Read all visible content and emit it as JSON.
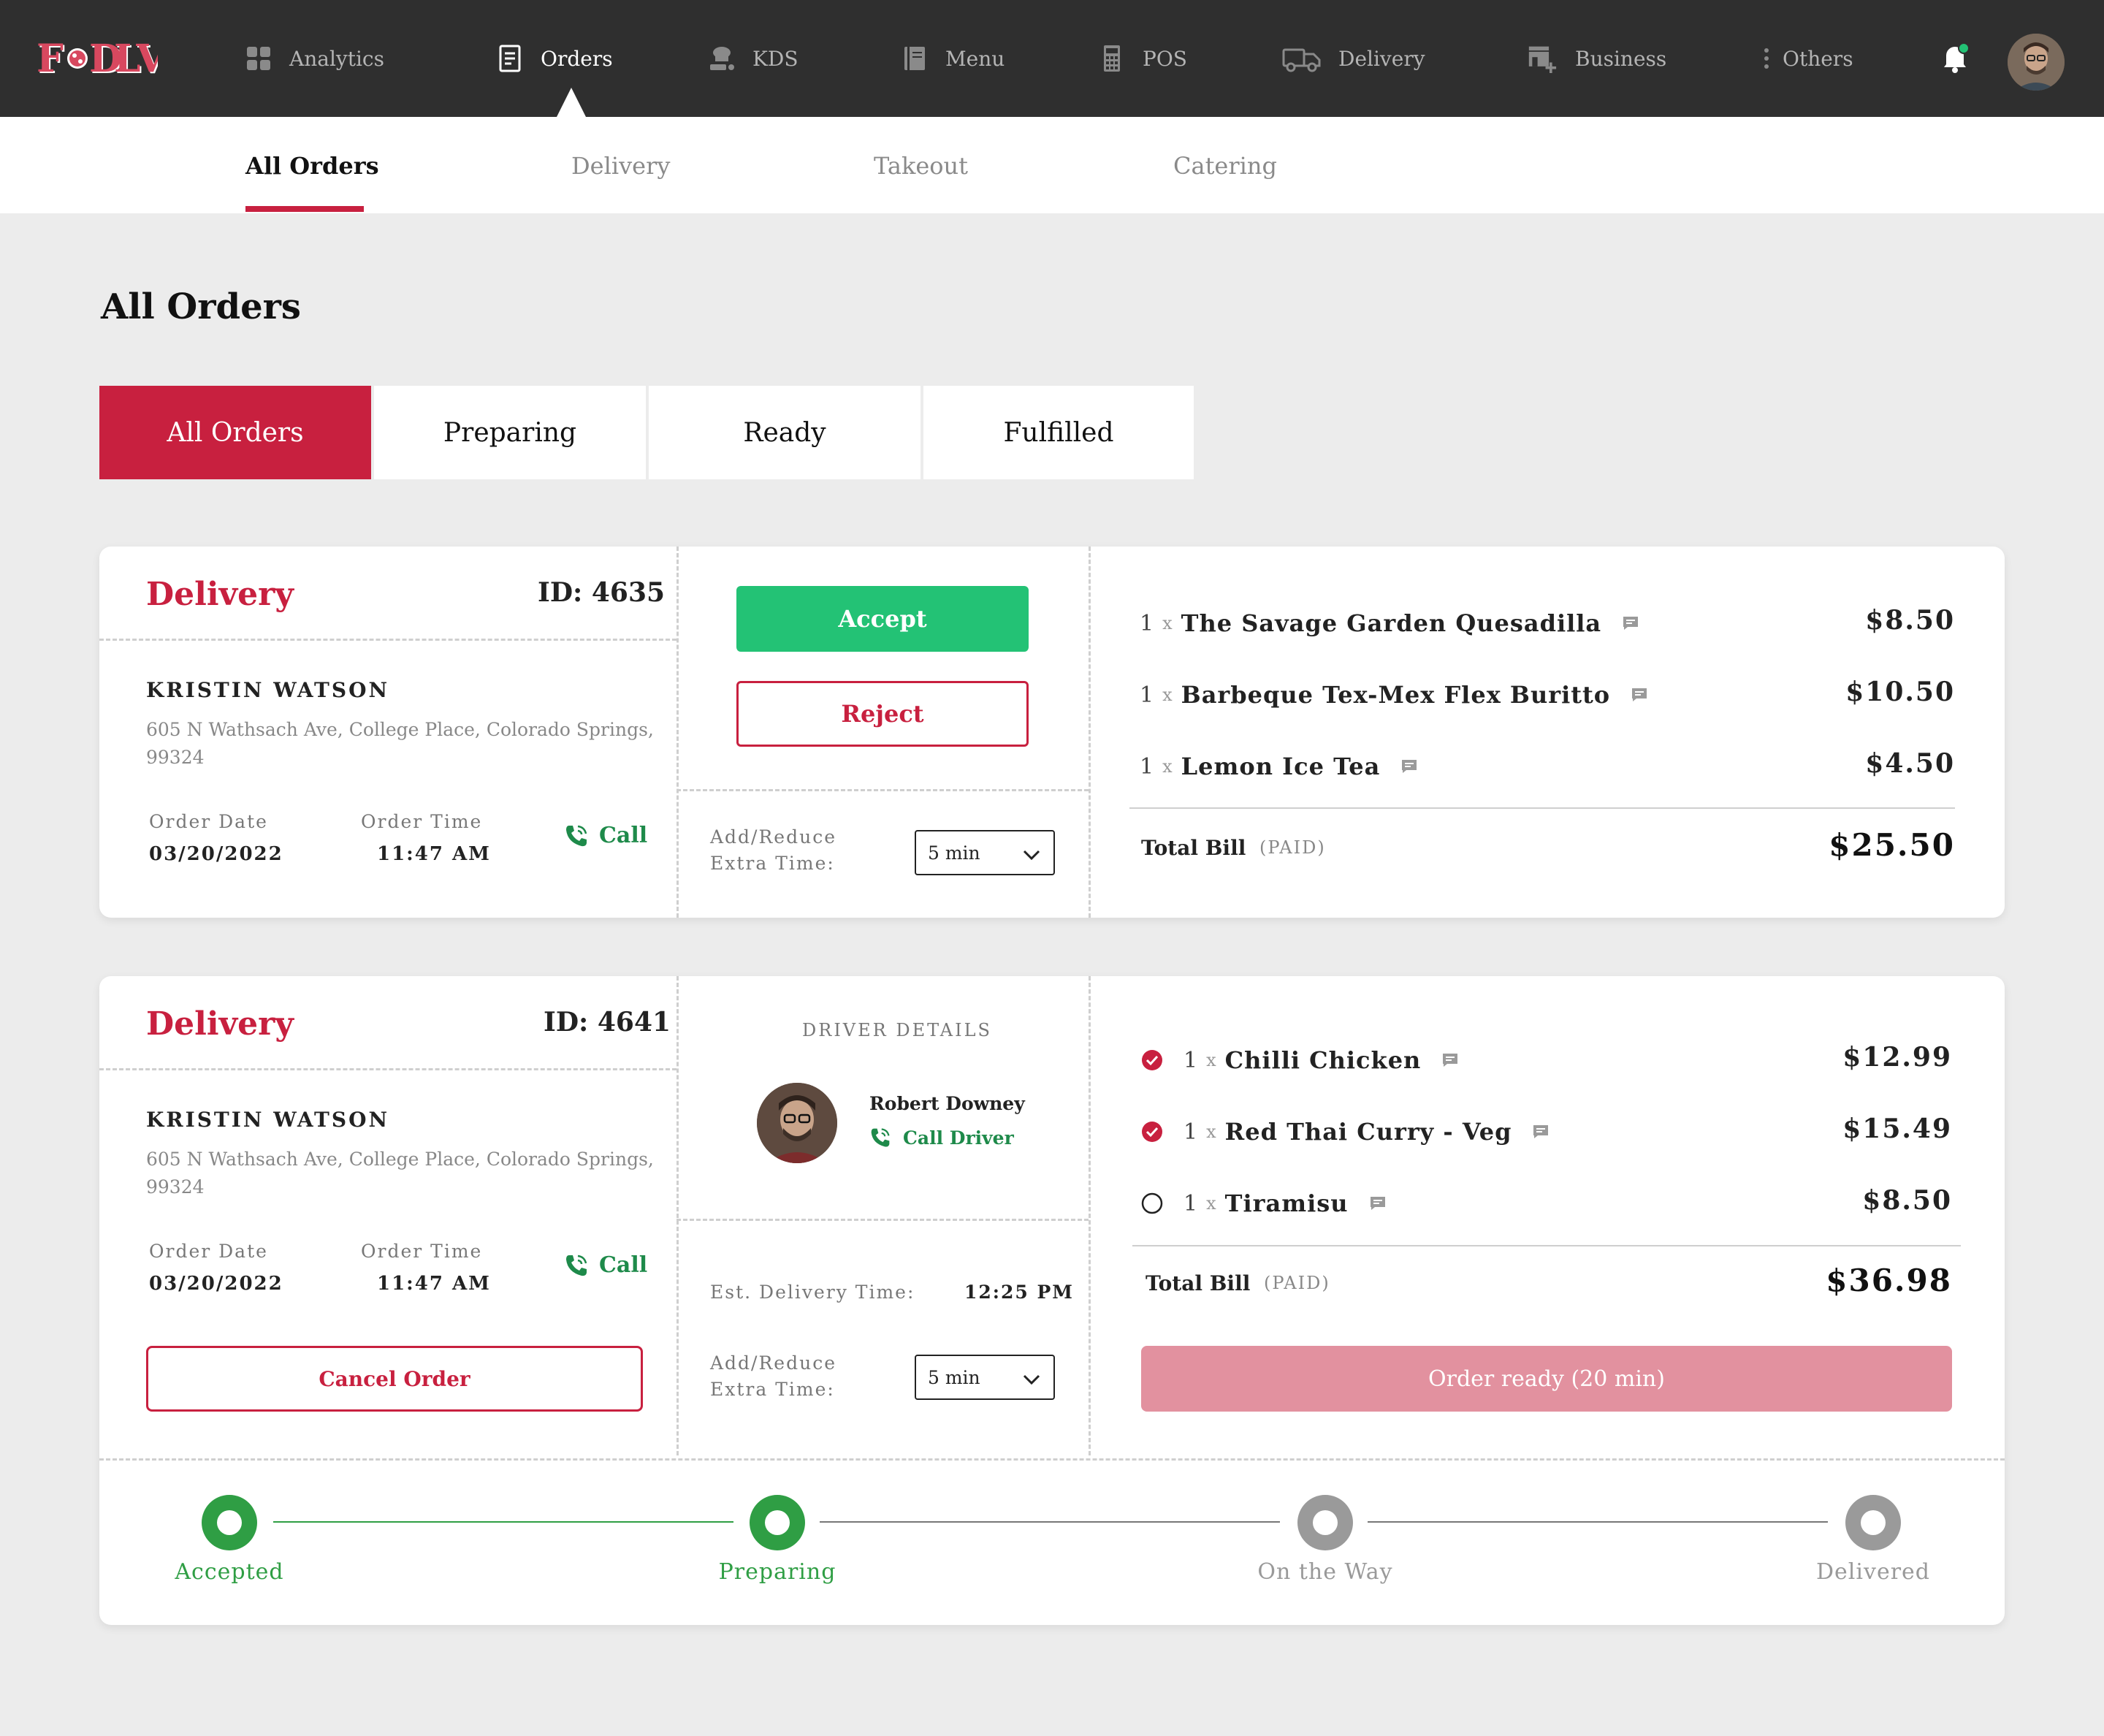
{
  "brand": {
    "logo_text": "FDLV",
    "accent": "#c8203f",
    "success": "#23c275",
    "progress_done": "#2f9e44",
    "nav_bg": "#2f2f2f"
  },
  "nav": [
    {
      "label": "Analytics",
      "icon": "grid-icon"
    },
    {
      "label": "Orders",
      "icon": "document-icon",
      "active": true
    },
    {
      "label": "KDS",
      "icon": "chef-icon"
    },
    {
      "label": "Menu",
      "icon": "book-icon"
    },
    {
      "label": "POS",
      "icon": "calculator-icon"
    },
    {
      "label": "Delivery",
      "icon": "truck-icon"
    },
    {
      "label": "Business",
      "icon": "store-icon"
    },
    {
      "label": "Others",
      "icon": "kebab-icon"
    }
  ],
  "subtabs": [
    "All Orders",
    "Delivery",
    "Takeout",
    "Catering"
  ],
  "page_title": "All Orders",
  "filters": [
    "All Orders",
    "Preparing",
    "Ready",
    "Fulfilled"
  ],
  "orders": [
    {
      "type": "Delivery",
      "id": "ID: 4635",
      "customer": "KRISTIN WATSON",
      "address": "605 N Wathsach Ave, College Place, Colorado Springs, 99324",
      "order_date_label": "Order Date",
      "order_date": "03/20/2022",
      "order_time_label": "Order Time",
      "order_time": "11:47 AM",
      "call": "Call",
      "accept": "Accept",
      "reject": "Reject",
      "extra_time_label": "Add/Reduce Extra Time:",
      "extra_time": "5 min",
      "items": [
        {
          "qty": "1",
          "x": "x",
          "name": "The Savage Garden Quesadilla",
          "price": "$8.50"
        },
        {
          "qty": "1",
          "x": "x",
          "name": "Barbeque Tex-Mex Flex Buritto",
          "price": "$10.50"
        },
        {
          "qty": "1",
          "x": "x",
          "name": "Lemon Ice Tea",
          "price": "$4.50"
        }
      ],
      "total_label": "Total Bill",
      "paid": "(PAID)",
      "total": "$25.50"
    },
    {
      "type": "Delivery",
      "id": "ID: 4641",
      "customer": "KRISTIN WATSON",
      "address": "605 N Wathsach Ave, College Place, Colorado Springs, 99324",
      "order_date_label": "Order Date",
      "order_date": "03/20/2022",
      "order_time_label": "Order Time",
      "order_time": "11:47 AM",
      "call": "Call",
      "cancel": "Cancel Order",
      "driver_title": "DRIVER DETAILS",
      "driver_name": "Robert Downey",
      "driver_call": "Call Driver",
      "est_label": "Est. Delivery Time:",
      "est_time": "12:25 PM",
      "extra_time_label": "Add/Reduce Extra Time:",
      "extra_time": "5 min",
      "items": [
        {
          "qty": "1",
          "x": "x",
          "name": "Chilli Chicken",
          "price": "$12.99",
          "checked": true
        },
        {
          "qty": "1",
          "x": "x",
          "name": "Red Thai Curry - Veg",
          "price": "$15.49",
          "checked": true
        },
        {
          "qty": "1",
          "x": "x",
          "name": "Tiramisu",
          "price": "$8.50",
          "checked": false
        }
      ],
      "total_label": "Total Bill",
      "paid": "(PAID)",
      "total": "$36.98",
      "ready_button": "Order ready (20 min)",
      "steps": [
        {
          "label": "Accepted",
          "done": true
        },
        {
          "label": "Preparing",
          "done": true
        },
        {
          "label": "On the Way",
          "done": false
        },
        {
          "label": "Delivered",
          "done": false
        }
      ]
    }
  ]
}
